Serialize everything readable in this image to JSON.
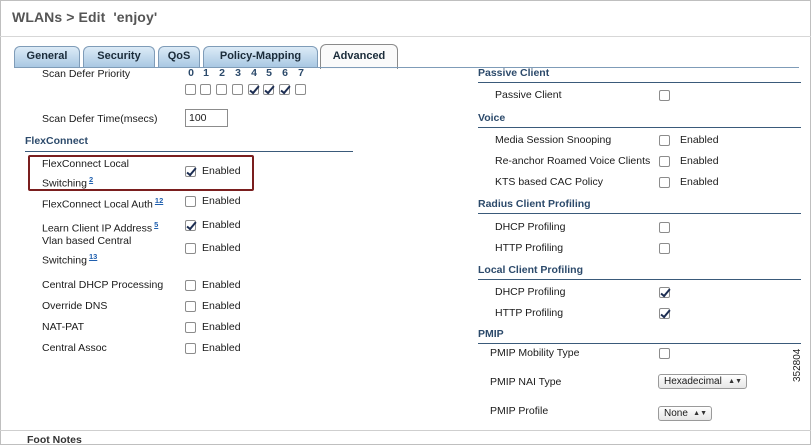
{
  "page_title": "WLANs > Edit  'enjoy'",
  "tabs": [
    "General",
    "Security",
    "QoS",
    "Policy-Mapping",
    "Advanced"
  ],
  "scan_defer_priority": {
    "label": "Scan Defer Priority",
    "numbers": [
      "0",
      "1",
      "2",
      "3",
      "4",
      "5",
      "6",
      "7"
    ],
    "checked": [
      false,
      false,
      false,
      false,
      true,
      true,
      true,
      false
    ]
  },
  "scan_defer_time": {
    "label": "Scan Defer Time(msecs)",
    "value": "100"
  },
  "enabled_text": "Enabled",
  "flexconnect": {
    "heading": "FlexConnect",
    "rows": [
      {
        "label": "FlexConnect Local Switching",
        "sup": "2",
        "checked": true
      },
      {
        "label": "FlexConnect Local Auth",
        "sup": "12",
        "checked": false
      },
      {
        "label": "Learn Client IP Address",
        "sup": "5",
        "checked": true
      },
      {
        "label": "Vlan based Central Switching",
        "sup": "13",
        "checked": false
      },
      {
        "label": "Central DHCP Processing",
        "sup": "",
        "checked": false
      },
      {
        "label": "Override DNS",
        "sup": "",
        "checked": false
      },
      {
        "label": "NAT-PAT",
        "sup": "",
        "checked": false
      },
      {
        "label": "Central Assoc",
        "sup": "",
        "checked": false
      }
    ]
  },
  "passive_client": {
    "heading": "Passive Client",
    "label": "Passive Client",
    "checked": false
  },
  "voice": {
    "heading": "Voice",
    "rows": [
      {
        "label": "Media Session Snooping",
        "checked": false
      },
      {
        "label": "Re-anchor Roamed Voice Clients",
        "checked": false
      },
      {
        "label": "KTS based CAC Policy",
        "checked": false
      }
    ]
  },
  "radius_profiling": {
    "heading": "Radius Client Profiling",
    "rows": [
      {
        "label": "DHCP Profiling",
        "checked": false
      },
      {
        "label": "HTTP Profiling",
        "checked": false
      }
    ]
  },
  "local_profiling": {
    "heading": "Local Client Profiling",
    "rows": [
      {
        "label": "DHCP Profiling",
        "checked": true
      },
      {
        "label": "HTTP Profiling",
        "checked": true
      }
    ]
  },
  "pmip": {
    "heading": "PMIP",
    "mobility_label": "PMIP Mobility Type",
    "mobility_checked": false,
    "nai_label": "PMIP NAI Type",
    "nai_value": "Hexadecimal",
    "profile_label": "PMIP Profile",
    "profile_value": "None"
  },
  "foot_notes": "Foot Notes",
  "figure_code": "352804",
  "colors": {
    "highlight_border": "#7a1e1e",
    "section_heading": "#2c4a6b",
    "tab_gradient_top": "#dcebf7",
    "tab_gradient_bottom": "#a9c8e3"
  }
}
